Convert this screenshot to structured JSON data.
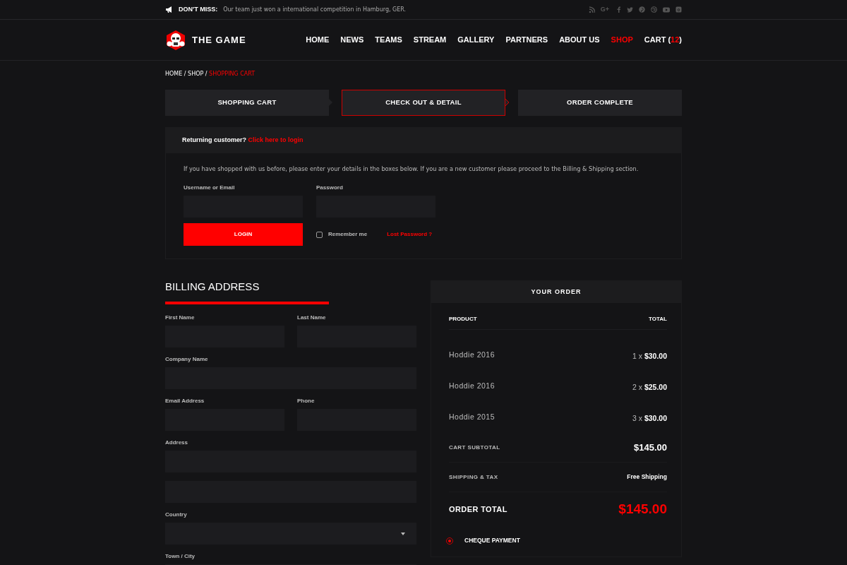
{
  "topbar": {
    "label": "DON'T MISS:",
    "message": "Our team just won a international competition in Hamburg, GER.",
    "social": [
      {
        "kind": "rss"
      },
      {
        "kind": "gplus",
        "label": "G+"
      },
      {
        "kind": "facebook"
      },
      {
        "kind": "twitter"
      },
      {
        "kind": "pinterest"
      },
      {
        "kind": "dribbble"
      },
      {
        "kind": "youtube"
      },
      {
        "kind": "instagram"
      }
    ]
  },
  "brand": "THE GAME",
  "nav": [
    {
      "label": "HOME",
      "selected": false
    },
    {
      "label": "NEWS",
      "selected": false
    },
    {
      "label": "TEAMS",
      "selected": false
    },
    {
      "label": "STREAM",
      "selected": false
    },
    {
      "label": "GALLERY",
      "selected": false
    },
    {
      "label": "PARTNERS",
      "selected": false
    },
    {
      "label": "ABOUT US",
      "selected": false
    },
    {
      "label": "SHOP",
      "selected": true
    },
    {
      "label": "CART (",
      "count": "12",
      "suffix": ")",
      "selected": false
    }
  ],
  "breadcrumb": [
    {
      "label": "HOME",
      "current": false,
      "separator": "/"
    },
    {
      "label": "SHOP",
      "current": false,
      "separator": "/"
    },
    {
      "label": "SHOPPING CART",
      "current": true
    }
  ],
  "steps": [
    {
      "label": "SHOPPING CART",
      "selected": false
    },
    {
      "label": "CHECK OUT & DETAIL",
      "selected": true
    },
    {
      "label": "ORDER COMPLETE",
      "selected": false
    }
  ],
  "login": {
    "prompt": "Returning customer?",
    "link": "Click here to login",
    "intro": "If you have shopped with us before, please enter your details in the boxes below. If you are a new customer please proceed to the Billing & Shipping section.",
    "username_label": "Username or Email",
    "password_label": "Password",
    "button": "LOGIN",
    "remember": {
      "label": "Remember me",
      "checked": false
    },
    "lost": "Lost Password ?"
  },
  "billing": {
    "title": "BILLING ADDRESS",
    "rows": [
      [
        {
          "label": "First Name",
          "kind": "text"
        },
        {
          "label": "Last Name",
          "kind": "text"
        }
      ],
      [
        {
          "label": "Company Name",
          "kind": "text"
        }
      ],
      [
        {
          "label": "Email Address",
          "kind": "text"
        },
        {
          "label": "Phone",
          "kind": "text"
        }
      ],
      [
        {
          "label": "Address",
          "kind": "text"
        }
      ],
      [
        {
          "kind": "text"
        }
      ],
      [
        {
          "label": "Country",
          "kind": "select"
        }
      ],
      [
        {
          "label": "Town / City",
          "kind": "text"
        }
      ]
    ]
  },
  "order": {
    "title": "YOUR ORDER",
    "columns": [
      "PRODUCT",
      "TOTAL"
    ],
    "items": [
      {
        "name": "Hoddie 2016",
        "qty": "1 x",
        "price": "$30.00"
      },
      {
        "name": "Hoddie 2016",
        "qty": "2 x",
        "price": "$25.00"
      },
      {
        "name": "Hoddie 2015",
        "qty": "3 x",
        "price": "$30.00"
      }
    ],
    "totals": [
      {
        "label": "CART SUBTOTAL",
        "value": "$145.00",
        "kind": "subtotal"
      },
      {
        "label": "SHIPPING & TAX",
        "value": "Free Shipping",
        "kind": "shipping"
      },
      {
        "label": "ORDER TOTAL",
        "value": "$145.00",
        "kind": "grand"
      }
    ],
    "payments": [
      {
        "label": "CHEQUE PAYMENT",
        "selected": true
      }
    ]
  }
}
